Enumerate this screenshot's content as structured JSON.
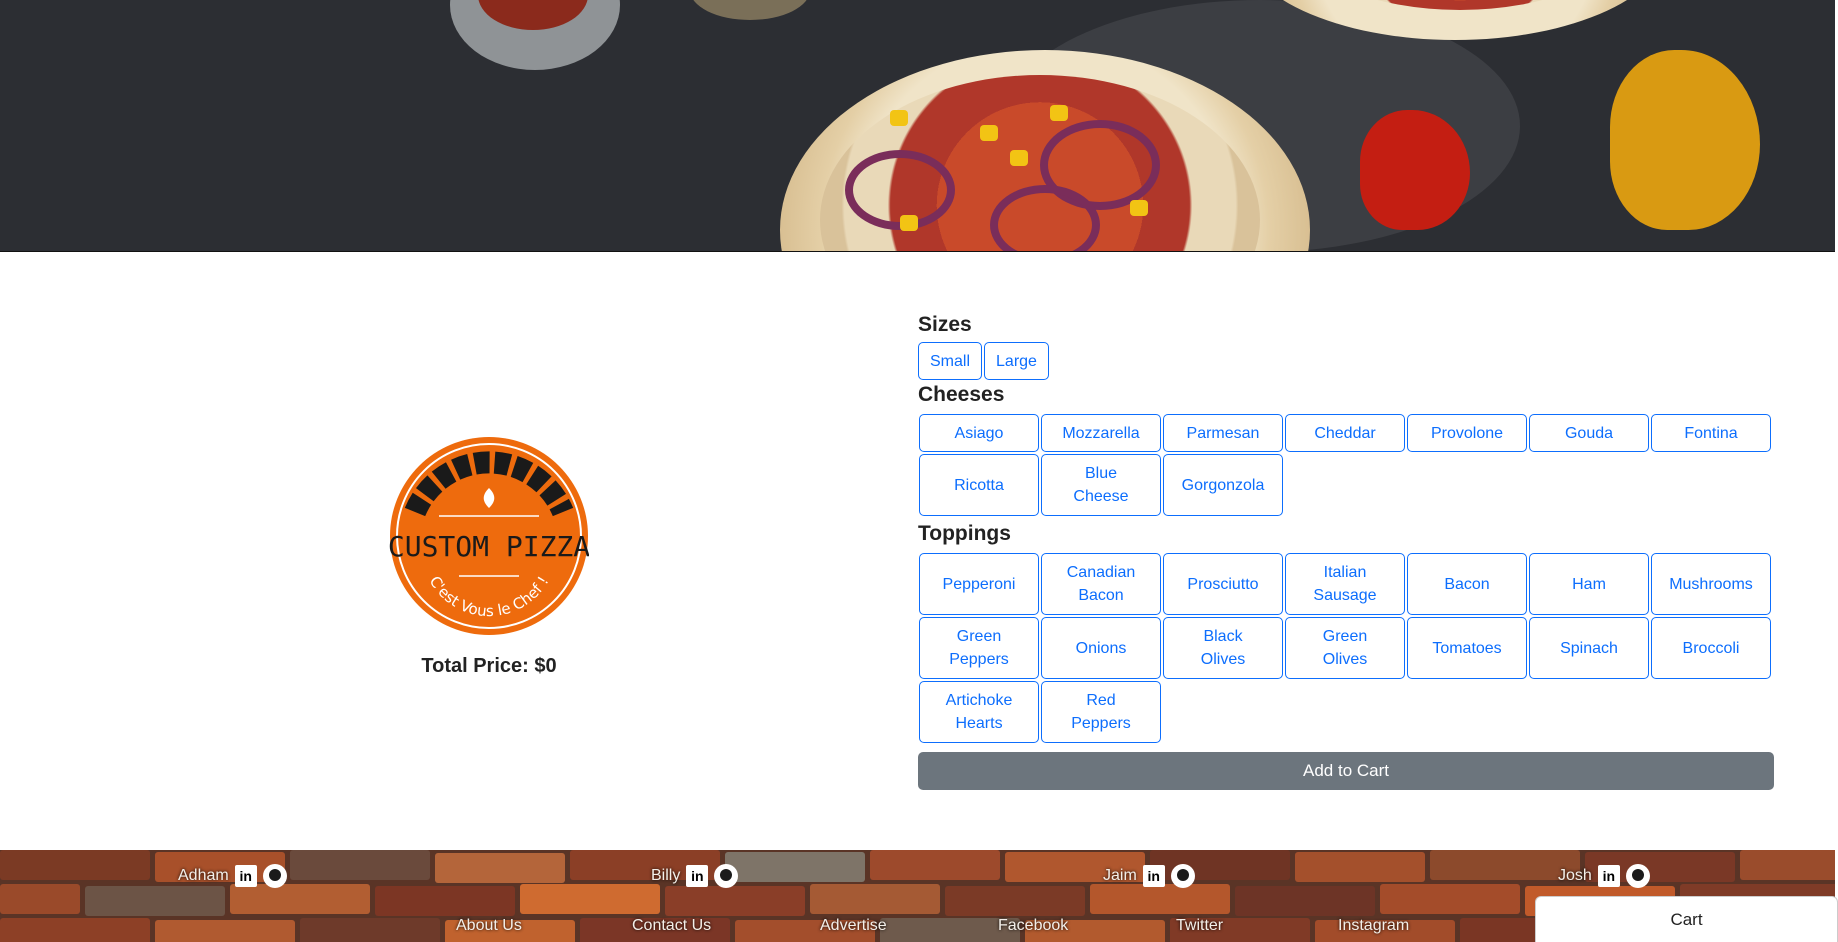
{
  "logo": {
    "title": "CUSTOM PIZZA",
    "tagline": "C'est Vous le Chef !"
  },
  "total_price": {
    "label": "Total Price: $0"
  },
  "sizes": {
    "title": "Sizes",
    "options": [
      "Small",
      "Large"
    ]
  },
  "cheeses": {
    "title": "Cheeses",
    "options": [
      "Asiago",
      "Mozzarella",
      "Parmesan",
      "Cheddar",
      "Provolone",
      "Gouda",
      "Fontina",
      "Ricotta",
      "Blue Cheese",
      "Gorgonzola"
    ]
  },
  "toppings": {
    "title": "Toppings",
    "options": [
      "Pepperoni",
      "Canadian Bacon",
      "Prosciutto",
      "Italian Sausage",
      "Bacon",
      "Ham",
      "Mushrooms",
      "Green Peppers",
      "Onions",
      "Black Olives",
      "Green Olives",
      "Tomatoes",
      "Spinach",
      "Broccoli",
      "Artichoke Hearts",
      "Red Peppers"
    ]
  },
  "add_to_cart": "Add to Cart",
  "developers": [
    {
      "name": "Adham",
      "linkedin_icon": "in"
    },
    {
      "name": "Billy",
      "linkedin_icon": "in"
    },
    {
      "name": "Jaim",
      "linkedin_icon": "in"
    },
    {
      "name": "Josh",
      "linkedin_icon": "in"
    }
  ],
  "footer_links": [
    "About Us",
    "Contact Us",
    "Advertise",
    "Facebook",
    "Twitter",
    "Instagram"
  ],
  "cart_tab": "Cart",
  "colors": {
    "accent": "#0d6efd",
    "logo_orange": "#ee6b0d",
    "add_to_cart_bg": "#6c757d"
  }
}
